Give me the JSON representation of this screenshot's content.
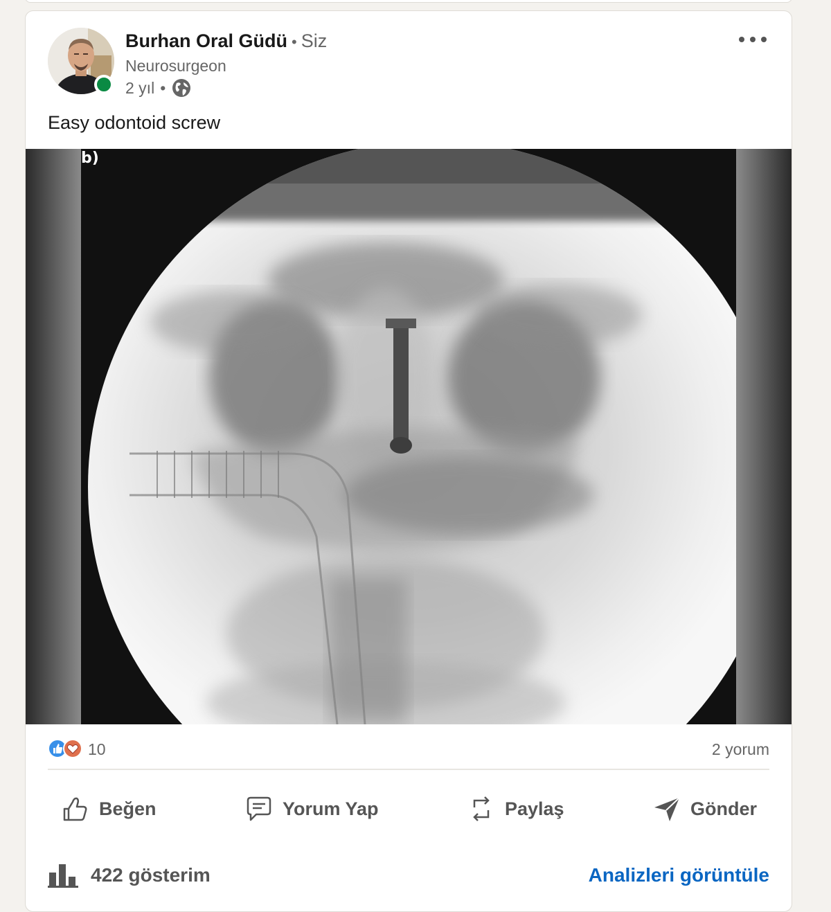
{
  "post": {
    "author": {
      "name": "Burhan Oral Güdü",
      "relation": "Siz",
      "separator": "•",
      "headline": "Neurosurgeon",
      "time": "2 yıl",
      "meta_separator": "•",
      "visibility_icon": "globe-icon",
      "online_status_color": "#0a8a43"
    },
    "text": "Easy odontoid screw",
    "media": {
      "corner_label": "b)"
    },
    "reactions": {
      "icons": [
        "like-reaction-icon",
        "love-reaction-icon"
      ],
      "count": "10",
      "comments": "2 yorum"
    },
    "actions": [
      {
        "label": "Beğen",
        "icon": "thumbs-up-icon"
      },
      {
        "label": "Yorum Yap",
        "icon": "comment-icon"
      },
      {
        "label": "Paylaş",
        "icon": "repost-icon"
      },
      {
        "label": "Gönder",
        "icon": "send-icon"
      }
    ],
    "footer": {
      "impressions": "422 gösterim",
      "impressions_icon": "bar-chart-icon",
      "analytics_link": "Analizleri görüntüle"
    }
  },
  "colors": {
    "link": "#0a66c2",
    "like": "#378fe9",
    "love": "#df704d",
    "online": "#0a8a43"
  }
}
